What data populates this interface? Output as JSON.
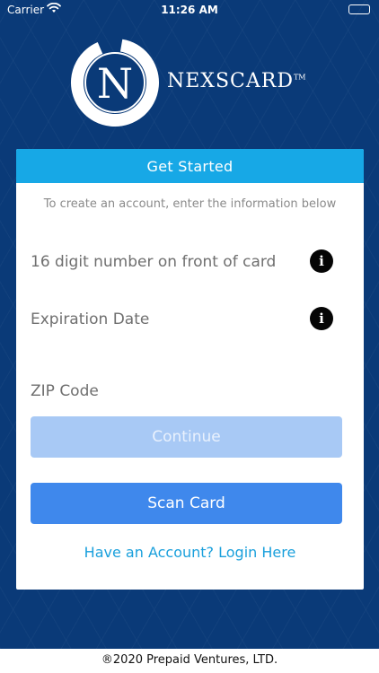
{
  "status_bar": {
    "carrier": "Carrier",
    "time": "11:26 AM"
  },
  "logo": {
    "letter": "N",
    "brand": "NEXSCARD",
    "trademark": "TM"
  },
  "card": {
    "header": "Get Started",
    "subtitle": "To create an account, enter the information below",
    "fields": [
      {
        "label": "16 digit number on front of card",
        "has_info": true
      },
      {
        "label": "Expiration Date",
        "has_info": true
      },
      {
        "label": "ZIP Code",
        "has_info": false
      }
    ],
    "info_glyph": "i",
    "continue_label": "Continue",
    "scan_label": "Scan Card",
    "login_link": "Have an Account? Login Here"
  },
  "footer": {
    "copyright": "®2020 Prepaid Ventures, LTD."
  },
  "colors": {
    "background": "#0a3a78",
    "header": "#17a8e6",
    "continue_disabled": "#a8c9f5",
    "scan_button": "#3f88ec",
    "link": "#1aa0dc"
  }
}
